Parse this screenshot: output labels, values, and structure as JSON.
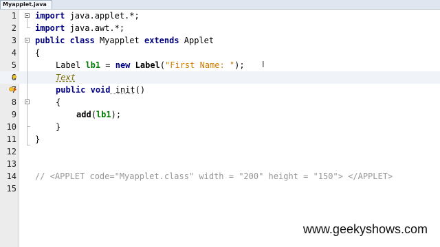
{
  "tab": {
    "label": "Myapplet.java"
  },
  "lines": [
    {
      "n": "1"
    },
    {
      "n": "2"
    },
    {
      "n": "3"
    },
    {
      "n": "4"
    },
    {
      "n": "5"
    },
    {
      "n": "6"
    },
    {
      "n": "7"
    },
    {
      "n": "8"
    },
    {
      "n": "9"
    },
    {
      "n": "10"
    },
    {
      "n": "11"
    },
    {
      "n": "12"
    },
    {
      "n": "13"
    },
    {
      "n": "14"
    },
    {
      "n": "15"
    }
  ],
  "code": {
    "l1": {
      "kw": "import",
      "rest": " java.applet.*;"
    },
    "l2": {
      "kw": "import",
      "rest": " java.awt.*;"
    },
    "l3": {
      "kw1": "public",
      "kw2": "class",
      "name": " Myapplet ",
      "kw3": "extends",
      "rest": " Applet"
    },
    "l4": {
      "text": "{"
    },
    "l5": {
      "type": "Label ",
      "field": "lb1",
      "eq": " = ",
      "kw": "new",
      "ctor": " Label",
      "open": "(",
      "str": "\"First Name: \"",
      "close": ");"
    },
    "l6": {
      "hint": "Text"
    },
    "l7": {
      "kw1": "public",
      "kw2": "void",
      "mth": " init",
      "rest": "()"
    },
    "l8": {
      "text": "{"
    },
    "l9": {
      "mth": "add",
      "open": "(",
      "field": "lb1",
      "close": ");"
    },
    "l10": {
      "text": "}"
    },
    "l11": {
      "text": "}"
    },
    "l14": {
      "comment": "// <APPLET code=\"Myapplet.class\" width = \"200\" height = \"150\"> </APPLET>"
    }
  },
  "watermark": "www.geekyshows.com",
  "icons": {
    "line6": "lightbulb-hint-icon",
    "line7": "override-warning-icon"
  }
}
